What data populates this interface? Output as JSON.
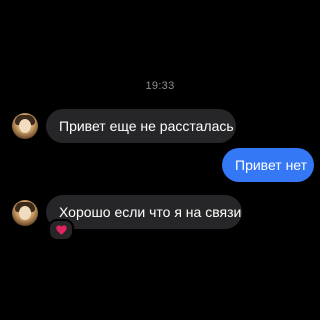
{
  "chat": {
    "timestamp": "19:33",
    "messages": [
      {
        "direction": "incoming",
        "text": "Привет еще не рассталась"
      },
      {
        "direction": "outgoing",
        "text": "Привет нет"
      },
      {
        "direction": "incoming",
        "text": "Хорошо если что я на связи",
        "reaction": "heart"
      }
    ]
  },
  "colors": {
    "background": "#000000",
    "incoming_bubble": "#262628",
    "outgoing_bubble": "#3478f6",
    "timestamp_text": "#8e8e93",
    "reaction_heart": "#e0245e"
  },
  "icons": {
    "reaction": "heart-icon",
    "avatar": "contact-avatar"
  }
}
